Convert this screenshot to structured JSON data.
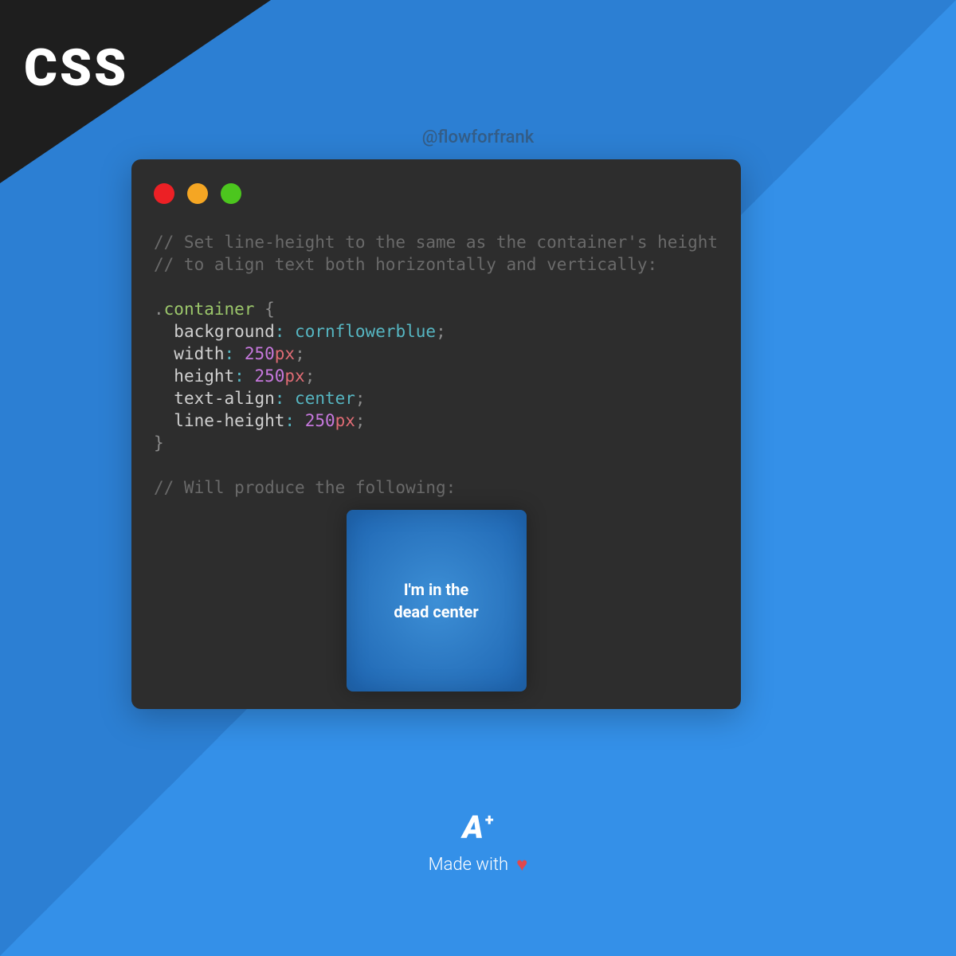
{
  "badge": {
    "label": "CSS"
  },
  "attribution": "@flowforfrank",
  "code": {
    "comment_line1": "// Set line-height to the same as the container's height",
    "comment_line2": "// to align text both horizontally and vertically:",
    "selector_dot": ".",
    "selector_name": "container",
    "brace_open": " {",
    "brace_close": "}",
    "rules": {
      "background": {
        "prop": "background",
        "value": "cornflowerblue"
      },
      "width": {
        "prop": "width",
        "num": "250",
        "unit": "px"
      },
      "height": {
        "prop": "height",
        "num": "250",
        "unit": "px"
      },
      "text_align": {
        "prop": "text-align",
        "value": "center"
      },
      "line_height": {
        "prop": "line-height",
        "num": "250",
        "unit": "px"
      }
    },
    "colon": ":",
    "punct_semi": ";",
    "result_comment": "// Will produce the following:"
  },
  "demo": {
    "line1": "I'm in the",
    "line2": "dead center"
  },
  "footer": {
    "logo_letter": "A",
    "logo_plus": "+",
    "made_with": "Made with",
    "heart": "♥"
  }
}
